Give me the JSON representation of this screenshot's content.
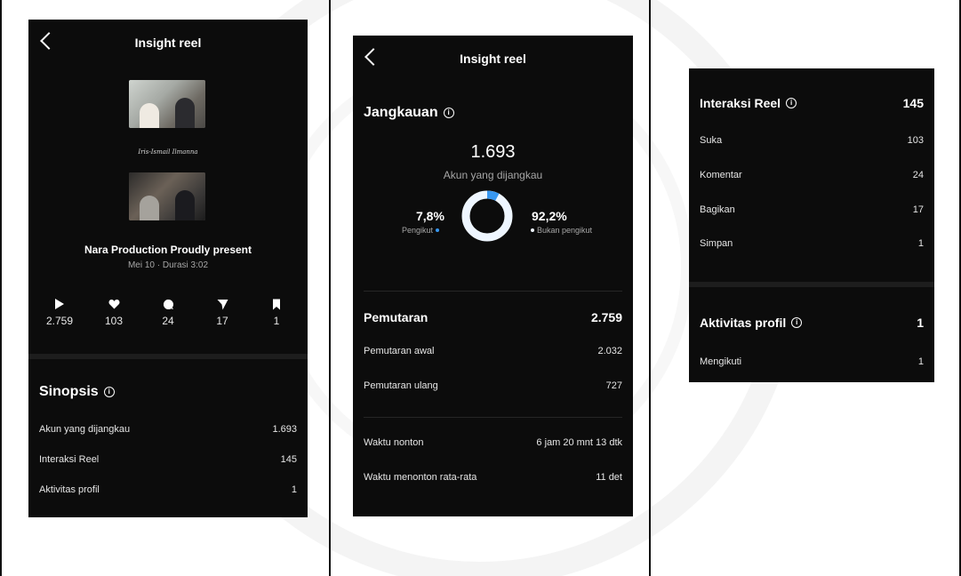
{
  "theme": {
    "bg": "#0c0c0c",
    "accent": "#3797f0",
    "ring": "#eef6ff",
    "muted": "#a6a6a6"
  },
  "screen1": {
    "title": "Insight reel",
    "thumb_caption": "Iris-Ismail Ilmanna",
    "reel_title": "Nara Production Proudly present",
    "reel_sub": "Mei 10 · Durasi 3:02",
    "stats": [
      {
        "icon": "play-icon",
        "value": "2.759"
      },
      {
        "icon": "heart-icon",
        "value": "103"
      },
      {
        "icon": "comment-icon",
        "value": "24"
      },
      {
        "icon": "share-icon",
        "value": "17"
      },
      {
        "icon": "bookmark-icon",
        "value": "1"
      }
    ],
    "sinopsis": {
      "title": "Sinopsis",
      "rows": [
        {
          "label": "Akun yang dijangkau",
          "value": "1.693"
        },
        {
          "label": "Interaksi Reel",
          "value": "145"
        },
        {
          "label": "Aktivitas profil",
          "value": "1"
        }
      ]
    }
  },
  "screen2": {
    "title": "Insight reel",
    "jangkauan_title": "Jangkauan",
    "accounts_reached": "1.693",
    "accounts_reached_label": "Akun yang dijangkau",
    "followers_pct": "7,8%",
    "followers_label": "Pengikut",
    "followers_fraction": 0.078,
    "non_followers_pct": "92,2%",
    "non_followers_label": "Bukan pengikut",
    "pemutaran": {
      "title": "Pemutaran",
      "value": "2.759",
      "rows": [
        {
          "label": "Pemutaran awal",
          "value": "2.032"
        },
        {
          "label": "Pemutaran ulang",
          "value": "727"
        }
      ]
    },
    "watch": [
      {
        "label": "Waktu nonton",
        "value": "6 jam 20 mnt 13 dtk"
      },
      {
        "label": "Waktu menonton rata-rata",
        "value": "11 det"
      }
    ]
  },
  "screen3": {
    "interaksi": {
      "title": "Interaksi Reel",
      "value": "145",
      "rows": [
        {
          "label": "Suka",
          "value": "103"
        },
        {
          "label": "Komentar",
          "value": "24"
        },
        {
          "label": "Bagikan",
          "value": "17"
        },
        {
          "label": "Simpan",
          "value": "1"
        }
      ]
    },
    "aktivitas": {
      "title": "Aktivitas profil",
      "value": "1",
      "rows": [
        {
          "label": "Mengikuti",
          "value": "1"
        }
      ]
    }
  }
}
